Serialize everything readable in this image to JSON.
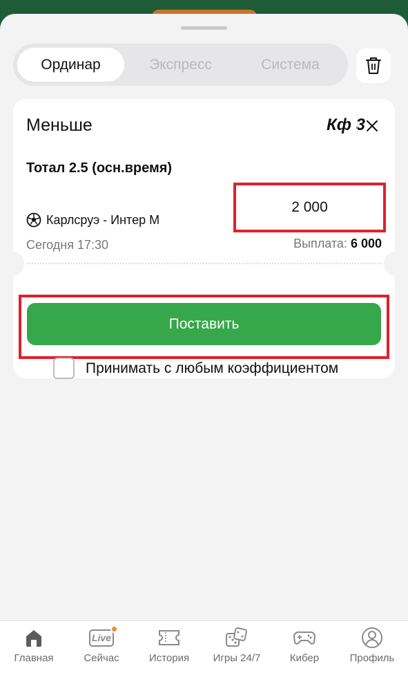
{
  "tabs": [
    {
      "label": "Ординар",
      "active": true
    },
    {
      "label": "Экспресс",
      "active": false
    },
    {
      "label": "Система",
      "active": false
    }
  ],
  "bet": {
    "selection": "Меньше",
    "coefficient": "Кф 3",
    "market": "Тотал 2.5 (осн.время)",
    "stake": "2 000",
    "event": "Карлсруэ - Интер М",
    "time": "Сегодня 17:30",
    "payout_label": "Выплата:",
    "payout_value": "6 000"
  },
  "actions": {
    "place_label": "Поставить",
    "accept_label": "Принимать с любым коэффициентом"
  },
  "nav": [
    {
      "label": "Главная",
      "icon": "home-icon"
    },
    {
      "label": "Сейчас",
      "icon": "live-icon",
      "badge_text": "Live"
    },
    {
      "label": "История",
      "icon": "ticket-icon"
    },
    {
      "label": "Игры 24/7",
      "icon": "dice-icon"
    },
    {
      "label": "Кибер",
      "icon": "gamepad-icon"
    },
    {
      "label": "Профиль",
      "icon": "profile-icon"
    }
  ],
  "colors": {
    "brand_green": "#36a74a",
    "header_green": "#1e5b37",
    "highlight_red": "#e0202c",
    "live_dot": "#f08a3a"
  }
}
